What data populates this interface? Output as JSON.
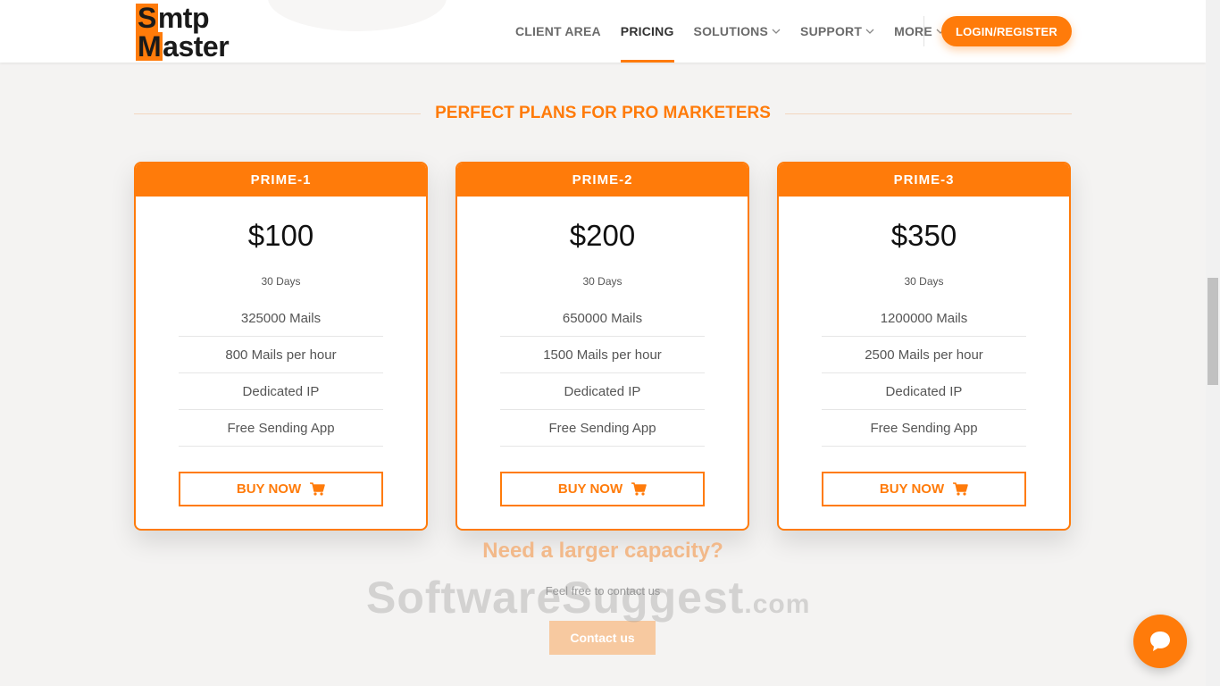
{
  "brand": {
    "logo_line1_cap": "S",
    "logo_line1_rest": "mtp",
    "logo_line2_cap": "M",
    "logo_line2_rest": "aster",
    "accent_color": "#ff7b0a"
  },
  "nav": {
    "items": [
      {
        "label": "CLIENT AREA",
        "dropdown": false,
        "active": false
      },
      {
        "label": "PRICING",
        "dropdown": false,
        "active": true
      },
      {
        "label": "SOLUTIONS",
        "dropdown": true,
        "active": false
      },
      {
        "label": "SUPPORT",
        "dropdown": true,
        "active": false
      },
      {
        "label": "MORE",
        "dropdown": true,
        "active": false
      }
    ],
    "login_label": "LOGIN/REGISTER"
  },
  "section": {
    "title": "PERFECT PLANS FOR PRO MARKETERS"
  },
  "plans": [
    {
      "name": "PRIME-1",
      "price": "$100",
      "period": "30 Days",
      "features": [
        "325000 Mails",
        "800 Mails per hour",
        "Dedicated IP",
        "Free Sending App"
      ],
      "cta": "BUY NOW"
    },
    {
      "name": "PRIME-2",
      "price": "$200",
      "period": "30 Days",
      "features": [
        "650000 Mails",
        "1500 Mails per hour",
        "Dedicated IP",
        "Free Sending App"
      ],
      "cta": "BUY NOW"
    },
    {
      "name": "PRIME-3",
      "price": "$350",
      "period": "30 Days",
      "features": [
        "1200000 Mails",
        "2500 Mails per hour",
        "Dedicated IP",
        "Free Sending App"
      ],
      "cta": "BUY NOW"
    }
  ],
  "larger": {
    "heading": "Need a larger capacity?",
    "subtext": "Feel free to contact us",
    "button": "Contact us"
  },
  "watermark": {
    "main": "SoftwareSuggest",
    "suffix": ".com"
  },
  "icons": {
    "cart": "cart-icon",
    "chevron": "chevron-down-icon",
    "chat": "chat-icon"
  }
}
